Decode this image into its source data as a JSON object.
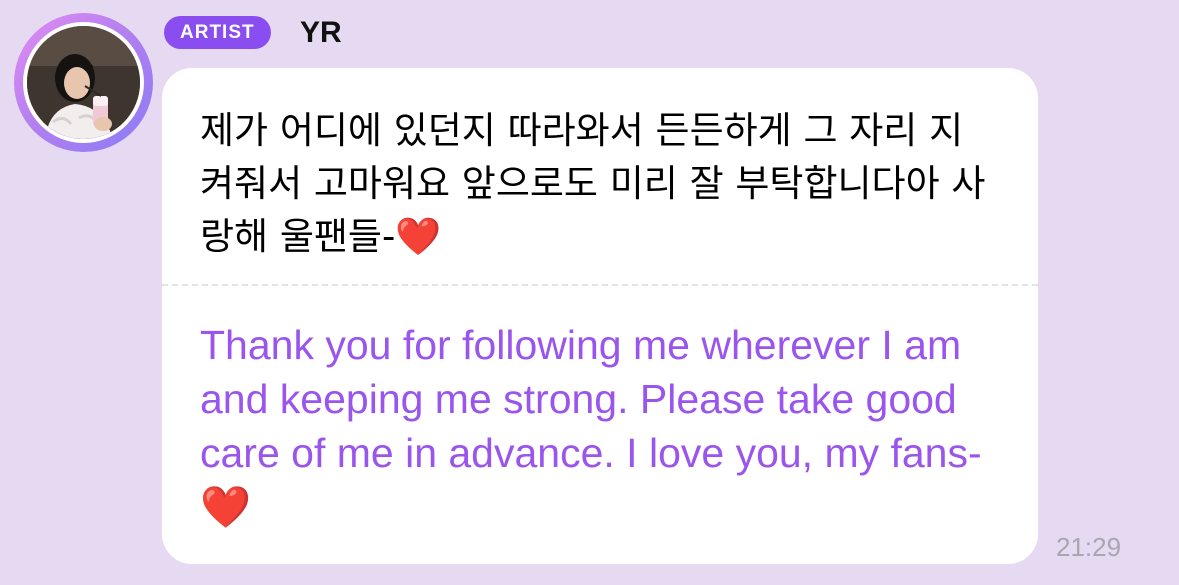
{
  "sender": {
    "badge_label": "ARTIST",
    "name": "YR",
    "avatar_icon": "profile-photo"
  },
  "message": {
    "original_text": "제가 어디에 있던지 따라와서 든든하게 그 자리 지켜줘서 고마워요 앞으로도 미리 잘 부탁합니다아 사랑해 울팬들-❤️",
    "translated_text": "Thank you for following me wherever I am and keeping me strong. Please take good care of me in advance. I love you, my fans-❤️",
    "time": "21:29"
  },
  "colors": {
    "background": "#e6daf3",
    "badge": "#8a4df0",
    "translation_text": "#9a55ec",
    "timestamp": "#a8a6ae"
  }
}
